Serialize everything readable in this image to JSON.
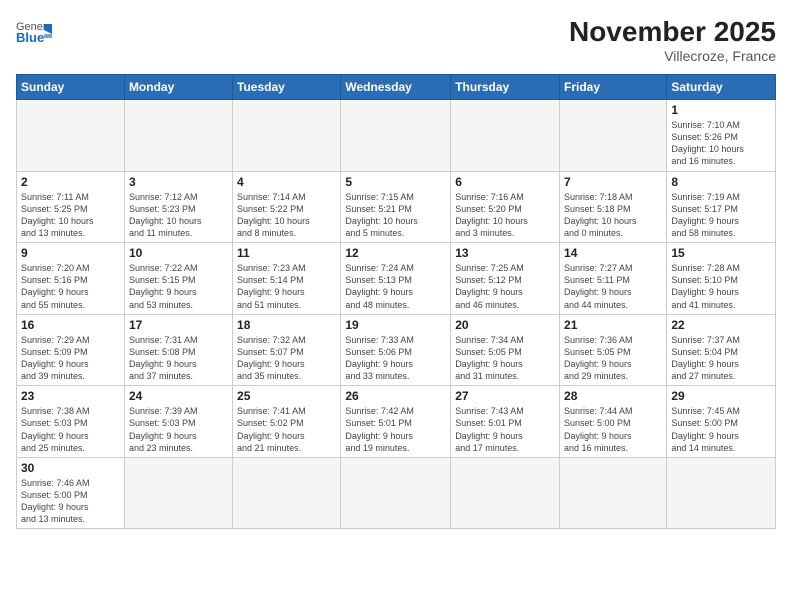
{
  "header": {
    "logo_general": "General",
    "logo_blue": "Blue",
    "month_year": "November 2025",
    "location": "Villecroze, France"
  },
  "weekdays": [
    "Sunday",
    "Monday",
    "Tuesday",
    "Wednesday",
    "Thursday",
    "Friday",
    "Saturday"
  ],
  "weeks": [
    [
      {
        "day": "",
        "info": ""
      },
      {
        "day": "",
        "info": ""
      },
      {
        "day": "",
        "info": ""
      },
      {
        "day": "",
        "info": ""
      },
      {
        "day": "",
        "info": ""
      },
      {
        "day": "",
        "info": ""
      },
      {
        "day": "1",
        "info": "Sunrise: 7:10 AM\nSunset: 5:26 PM\nDaylight: 10 hours\nand 16 minutes."
      }
    ],
    [
      {
        "day": "2",
        "info": "Sunrise: 7:11 AM\nSunset: 5:25 PM\nDaylight: 10 hours\nand 13 minutes."
      },
      {
        "day": "3",
        "info": "Sunrise: 7:12 AM\nSunset: 5:23 PM\nDaylight: 10 hours\nand 11 minutes."
      },
      {
        "day": "4",
        "info": "Sunrise: 7:14 AM\nSunset: 5:22 PM\nDaylight: 10 hours\nand 8 minutes."
      },
      {
        "day": "5",
        "info": "Sunrise: 7:15 AM\nSunset: 5:21 PM\nDaylight: 10 hours\nand 5 minutes."
      },
      {
        "day": "6",
        "info": "Sunrise: 7:16 AM\nSunset: 5:20 PM\nDaylight: 10 hours\nand 3 minutes."
      },
      {
        "day": "7",
        "info": "Sunrise: 7:18 AM\nSunset: 5:18 PM\nDaylight: 10 hours\nand 0 minutes."
      },
      {
        "day": "8",
        "info": "Sunrise: 7:19 AM\nSunset: 5:17 PM\nDaylight: 9 hours\nand 58 minutes."
      }
    ],
    [
      {
        "day": "9",
        "info": "Sunrise: 7:20 AM\nSunset: 5:16 PM\nDaylight: 9 hours\nand 55 minutes."
      },
      {
        "day": "10",
        "info": "Sunrise: 7:22 AM\nSunset: 5:15 PM\nDaylight: 9 hours\nand 53 minutes."
      },
      {
        "day": "11",
        "info": "Sunrise: 7:23 AM\nSunset: 5:14 PM\nDaylight: 9 hours\nand 51 minutes."
      },
      {
        "day": "12",
        "info": "Sunrise: 7:24 AM\nSunset: 5:13 PM\nDaylight: 9 hours\nand 48 minutes."
      },
      {
        "day": "13",
        "info": "Sunrise: 7:25 AM\nSunset: 5:12 PM\nDaylight: 9 hours\nand 46 minutes."
      },
      {
        "day": "14",
        "info": "Sunrise: 7:27 AM\nSunset: 5:11 PM\nDaylight: 9 hours\nand 44 minutes."
      },
      {
        "day": "15",
        "info": "Sunrise: 7:28 AM\nSunset: 5:10 PM\nDaylight: 9 hours\nand 41 minutes."
      }
    ],
    [
      {
        "day": "16",
        "info": "Sunrise: 7:29 AM\nSunset: 5:09 PM\nDaylight: 9 hours\nand 39 minutes."
      },
      {
        "day": "17",
        "info": "Sunrise: 7:31 AM\nSunset: 5:08 PM\nDaylight: 9 hours\nand 37 minutes."
      },
      {
        "day": "18",
        "info": "Sunrise: 7:32 AM\nSunset: 5:07 PM\nDaylight: 9 hours\nand 35 minutes."
      },
      {
        "day": "19",
        "info": "Sunrise: 7:33 AM\nSunset: 5:06 PM\nDaylight: 9 hours\nand 33 minutes."
      },
      {
        "day": "20",
        "info": "Sunrise: 7:34 AM\nSunset: 5:05 PM\nDaylight: 9 hours\nand 31 minutes."
      },
      {
        "day": "21",
        "info": "Sunrise: 7:36 AM\nSunset: 5:05 PM\nDaylight: 9 hours\nand 29 minutes."
      },
      {
        "day": "22",
        "info": "Sunrise: 7:37 AM\nSunset: 5:04 PM\nDaylight: 9 hours\nand 27 minutes."
      }
    ],
    [
      {
        "day": "23",
        "info": "Sunrise: 7:38 AM\nSunset: 5:03 PM\nDaylight: 9 hours\nand 25 minutes."
      },
      {
        "day": "24",
        "info": "Sunrise: 7:39 AM\nSunset: 5:03 PM\nDaylight: 9 hours\nand 23 minutes."
      },
      {
        "day": "25",
        "info": "Sunrise: 7:41 AM\nSunset: 5:02 PM\nDaylight: 9 hours\nand 21 minutes."
      },
      {
        "day": "26",
        "info": "Sunrise: 7:42 AM\nSunset: 5:01 PM\nDaylight: 9 hours\nand 19 minutes."
      },
      {
        "day": "27",
        "info": "Sunrise: 7:43 AM\nSunset: 5:01 PM\nDaylight: 9 hours\nand 17 minutes."
      },
      {
        "day": "28",
        "info": "Sunrise: 7:44 AM\nSunset: 5:00 PM\nDaylight: 9 hours\nand 16 minutes."
      },
      {
        "day": "29",
        "info": "Sunrise: 7:45 AM\nSunset: 5:00 PM\nDaylight: 9 hours\nand 14 minutes."
      }
    ],
    [
      {
        "day": "30",
        "info": "Sunrise: 7:46 AM\nSunset: 5:00 PM\nDaylight: 9 hours\nand 13 minutes."
      },
      {
        "day": "",
        "info": ""
      },
      {
        "day": "",
        "info": ""
      },
      {
        "day": "",
        "info": ""
      },
      {
        "day": "",
        "info": ""
      },
      {
        "day": "",
        "info": ""
      },
      {
        "day": "",
        "info": ""
      }
    ]
  ]
}
